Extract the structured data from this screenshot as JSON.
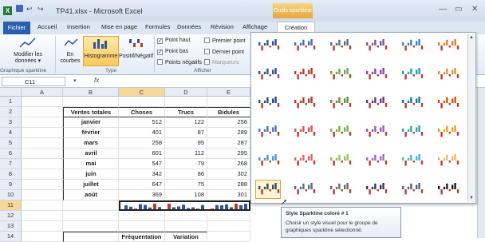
{
  "title_bar": {
    "quick_access": [
      "↩",
      "↪"
    ],
    "title": "TP41.xlsx - Microsoft Excel",
    "context_group": "Outils sparkline",
    "win": [
      "—",
      "▭",
      "✕"
    ]
  },
  "tabs": {
    "file": "Fichier",
    "items": [
      "Accueil",
      "Insertion",
      "Mise en page",
      "Formules",
      "Données",
      "Révision",
      "Affichage"
    ],
    "context_tab": "Création"
  },
  "ribbon": {
    "edit_data": "Modifier les données ▾",
    "group_sparkline": "Graphique sparkline",
    "type_line": "En courbes",
    "type_column": "Histogramme",
    "type_winloss": "Positif/Négatif",
    "group_type": "Type",
    "checkboxes": [
      {
        "label": "Point haut",
        "checked": true
      },
      {
        "label": "Point bas",
        "checked": true
      },
      {
        "label": "Points négatifs",
        "checked": false
      },
      {
        "label": "Premier point",
        "checked": false
      },
      {
        "label": "Dernier point",
        "checked": false
      },
      {
        "label": "Marqueurs",
        "checked": false
      }
    ],
    "group_show": "Afficher"
  },
  "formula": {
    "name_box": "C11",
    "fx": "fx"
  },
  "columns": [
    "A",
    "B",
    "C",
    "D",
    "E"
  ],
  "rows": [
    "1",
    "2",
    "3",
    "4",
    "5",
    "6",
    "7",
    "8",
    "9",
    "10",
    "11",
    "12",
    "13",
    "14"
  ],
  "table": {
    "headers": [
      "Ventes totales",
      "Choses",
      "Trucs",
      "Bidules"
    ],
    "months": [
      "janvier",
      "février",
      "mars",
      "avril",
      "mai",
      "juin",
      "juillet",
      "août"
    ],
    "choses": [
      "512",
      "401",
      "258",
      "601",
      "547",
      "342",
      "647",
      "369"
    ],
    "trucs": [
      "122",
      "87",
      "95",
      "112",
      "79",
      "86",
      "75",
      "108"
    ],
    "bidules": [
      "256",
      "289",
      "287",
      "295",
      "268",
      "302",
      "288",
      "301"
    ],
    "row14": [
      "Fréquentation",
      "Variation"
    ]
  },
  "gallery": {
    "colors": [
      [
        "#2f5597",
        "#3f6fb6",
        "#5b6b7e",
        "#7a52a0",
        "#2e8ab0",
        "#e07b2b"
      ],
      [
        "#2f5597",
        "#c0392b",
        "#6aa84f",
        "#8e44ad",
        "#1f9fb8",
        "#e69138"
      ],
      [
        "#1d4e89",
        "#b03a2e",
        "#5d8f3a",
        "#6c3483",
        "#117a8b",
        "#d35400"
      ],
      [
        "#4a78c2",
        "#d9534f",
        "#7cb342",
        "#9b59b6",
        "#26a69a",
        "#f39c12"
      ],
      [
        "#5b8bd6",
        "#e06666",
        "#8fc35a",
        "#a569bd",
        "#45b7c9",
        "#f6b26b"
      ],
      [
        "#3c4a5a",
        "#4f6f8f",
        "#6b6b6b",
        "#2c3e50",
        "#4b6584",
        "#1a1a1a"
      ]
    ]
  },
  "tooltip": {
    "title": "Style Sparkline coloré # 1",
    "desc": "Choisir un style visuel pour le groupe de graphiques sparkline sélectionné."
  }
}
